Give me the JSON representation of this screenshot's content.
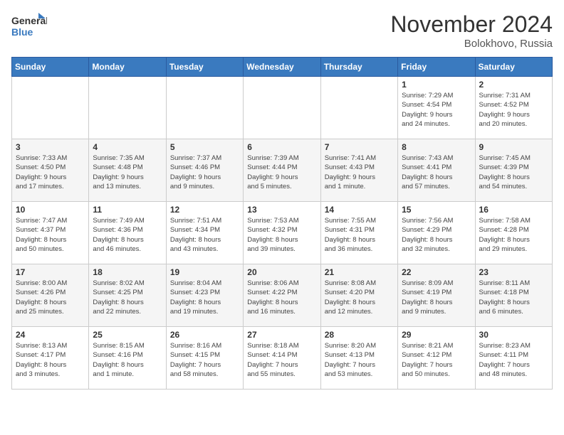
{
  "logo": {
    "line1": "General",
    "line2": "Blue"
  },
  "title": "November 2024",
  "location": "Bolokhovo, Russia",
  "days_of_week": [
    "Sunday",
    "Monday",
    "Tuesday",
    "Wednesday",
    "Thursday",
    "Friday",
    "Saturday"
  ],
  "weeks": [
    [
      {
        "day": "",
        "info": ""
      },
      {
        "day": "",
        "info": ""
      },
      {
        "day": "",
        "info": ""
      },
      {
        "day": "",
        "info": ""
      },
      {
        "day": "",
        "info": ""
      },
      {
        "day": "1",
        "info": "Sunrise: 7:29 AM\nSunset: 4:54 PM\nDaylight: 9 hours\nand 24 minutes."
      },
      {
        "day": "2",
        "info": "Sunrise: 7:31 AM\nSunset: 4:52 PM\nDaylight: 9 hours\nand 20 minutes."
      }
    ],
    [
      {
        "day": "3",
        "info": "Sunrise: 7:33 AM\nSunset: 4:50 PM\nDaylight: 9 hours\nand 17 minutes."
      },
      {
        "day": "4",
        "info": "Sunrise: 7:35 AM\nSunset: 4:48 PM\nDaylight: 9 hours\nand 13 minutes."
      },
      {
        "day": "5",
        "info": "Sunrise: 7:37 AM\nSunset: 4:46 PM\nDaylight: 9 hours\nand 9 minutes."
      },
      {
        "day": "6",
        "info": "Sunrise: 7:39 AM\nSunset: 4:44 PM\nDaylight: 9 hours\nand 5 minutes."
      },
      {
        "day": "7",
        "info": "Sunrise: 7:41 AM\nSunset: 4:43 PM\nDaylight: 9 hours\nand 1 minute."
      },
      {
        "day": "8",
        "info": "Sunrise: 7:43 AM\nSunset: 4:41 PM\nDaylight: 8 hours\nand 57 minutes."
      },
      {
        "day": "9",
        "info": "Sunrise: 7:45 AM\nSunset: 4:39 PM\nDaylight: 8 hours\nand 54 minutes."
      }
    ],
    [
      {
        "day": "10",
        "info": "Sunrise: 7:47 AM\nSunset: 4:37 PM\nDaylight: 8 hours\nand 50 minutes."
      },
      {
        "day": "11",
        "info": "Sunrise: 7:49 AM\nSunset: 4:36 PM\nDaylight: 8 hours\nand 46 minutes."
      },
      {
        "day": "12",
        "info": "Sunrise: 7:51 AM\nSunset: 4:34 PM\nDaylight: 8 hours\nand 43 minutes."
      },
      {
        "day": "13",
        "info": "Sunrise: 7:53 AM\nSunset: 4:32 PM\nDaylight: 8 hours\nand 39 minutes."
      },
      {
        "day": "14",
        "info": "Sunrise: 7:55 AM\nSunset: 4:31 PM\nDaylight: 8 hours\nand 36 minutes."
      },
      {
        "day": "15",
        "info": "Sunrise: 7:56 AM\nSunset: 4:29 PM\nDaylight: 8 hours\nand 32 minutes."
      },
      {
        "day": "16",
        "info": "Sunrise: 7:58 AM\nSunset: 4:28 PM\nDaylight: 8 hours\nand 29 minutes."
      }
    ],
    [
      {
        "day": "17",
        "info": "Sunrise: 8:00 AM\nSunset: 4:26 PM\nDaylight: 8 hours\nand 25 minutes."
      },
      {
        "day": "18",
        "info": "Sunrise: 8:02 AM\nSunset: 4:25 PM\nDaylight: 8 hours\nand 22 minutes."
      },
      {
        "day": "19",
        "info": "Sunrise: 8:04 AM\nSunset: 4:23 PM\nDaylight: 8 hours\nand 19 minutes."
      },
      {
        "day": "20",
        "info": "Sunrise: 8:06 AM\nSunset: 4:22 PM\nDaylight: 8 hours\nand 16 minutes."
      },
      {
        "day": "21",
        "info": "Sunrise: 8:08 AM\nSunset: 4:20 PM\nDaylight: 8 hours\nand 12 minutes."
      },
      {
        "day": "22",
        "info": "Sunrise: 8:09 AM\nSunset: 4:19 PM\nDaylight: 8 hours\nand 9 minutes."
      },
      {
        "day": "23",
        "info": "Sunrise: 8:11 AM\nSunset: 4:18 PM\nDaylight: 8 hours\nand 6 minutes."
      }
    ],
    [
      {
        "day": "24",
        "info": "Sunrise: 8:13 AM\nSunset: 4:17 PM\nDaylight: 8 hours\nand 3 minutes."
      },
      {
        "day": "25",
        "info": "Sunrise: 8:15 AM\nSunset: 4:16 PM\nDaylight: 8 hours\nand 1 minute."
      },
      {
        "day": "26",
        "info": "Sunrise: 8:16 AM\nSunset: 4:15 PM\nDaylight: 7 hours\nand 58 minutes."
      },
      {
        "day": "27",
        "info": "Sunrise: 8:18 AM\nSunset: 4:14 PM\nDaylight: 7 hours\nand 55 minutes."
      },
      {
        "day": "28",
        "info": "Sunrise: 8:20 AM\nSunset: 4:13 PM\nDaylight: 7 hours\nand 53 minutes."
      },
      {
        "day": "29",
        "info": "Sunrise: 8:21 AM\nSunset: 4:12 PM\nDaylight: 7 hours\nand 50 minutes."
      },
      {
        "day": "30",
        "info": "Sunrise: 8:23 AM\nSunset: 4:11 PM\nDaylight: 7 hours\nand 48 minutes."
      }
    ]
  ]
}
